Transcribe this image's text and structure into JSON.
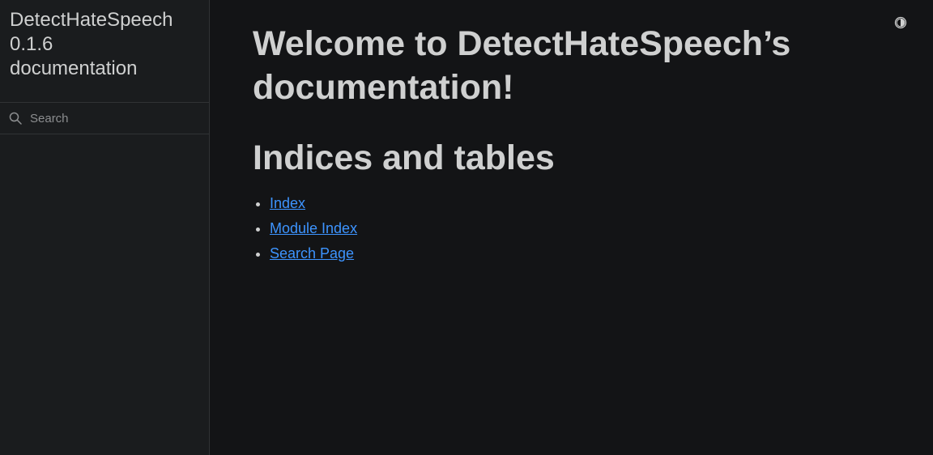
{
  "sidebar": {
    "brand": {
      "line1": "DetectHateSpeech",
      "line2": "0.1.6",
      "line3": "documentation"
    },
    "search": {
      "placeholder": "Search",
      "icon": "search-icon"
    }
  },
  "header": {
    "theme_toggle_icon": "contrast-icon"
  },
  "main": {
    "title": "Welcome to DetectHateSpeech’s documentation!",
    "section_title": "Indices and tables",
    "links": [
      {
        "label": "Index"
      },
      {
        "label": "Module Index"
      },
      {
        "label": "Search Page"
      }
    ]
  },
  "colors": {
    "background": "#131416",
    "sidebar": "#1a1c1e",
    "text": "#cfd0d0",
    "link": "#3d94ff",
    "border": "#303335"
  }
}
